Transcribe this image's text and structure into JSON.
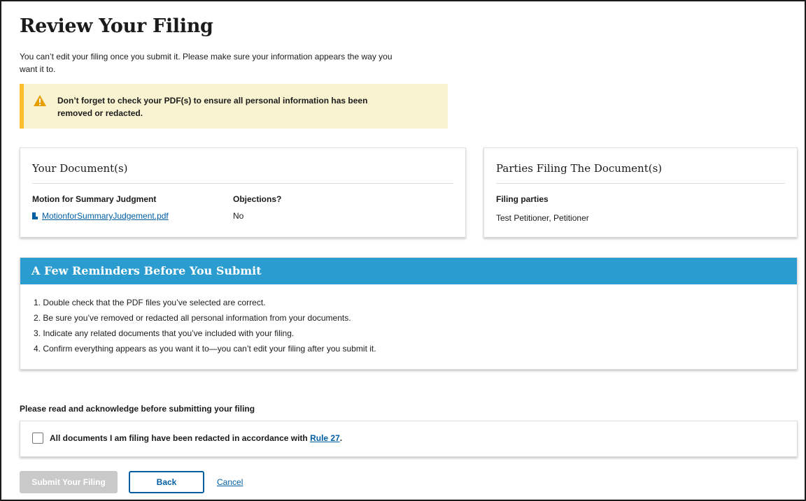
{
  "page": {
    "title": "Review Your Filing",
    "intro": "You can’t edit your filing once you submit it. Please make sure your information appears the way you want it to."
  },
  "warning": {
    "icon": "warning-triangle-icon",
    "text": "Don’t forget to check your PDF(s) to ensure all personal information has been removed or redacted.",
    "colors": {
      "background": "#faf3d1",
      "accent": "#ffbe2e"
    }
  },
  "documents_card": {
    "title": "Your Document(s)",
    "document_label": "Motion for Summary Judgment",
    "file_name": "MotionforSummaryJudgement.pdf",
    "file_icon": "pdf-file-icon",
    "objections_label": "Objections?",
    "objections_value": "No"
  },
  "parties_card": {
    "title": "Parties Filing The Document(s)",
    "label": "Filing parties",
    "value": "Test Petitioner, Petitioner"
  },
  "reminders": {
    "title": "A Few Reminders Before You Submit",
    "header_color": "#2b9ccf",
    "items": [
      "1. Double check that the PDF files you’ve selected are correct.",
      "2. Be sure you’ve removed or redacted all personal information from your documents.",
      "3. Indicate any related documents that you’ve included with your filing.",
      "4. Confirm everything appears as you want it to—you can’t edit your filing after you submit it."
    ]
  },
  "acknowledge": {
    "heading": "Please read and acknowledge before submitting your filing",
    "checkbox_text": "All documents I am filing have been redacted in accordance with ",
    "rule_link": "Rule 27",
    "period": ".",
    "checked": false
  },
  "actions": {
    "submit_label": "Submit Your Filing",
    "back_label": "Back",
    "cancel_label": "Cancel",
    "link_color": "#005ea2"
  }
}
